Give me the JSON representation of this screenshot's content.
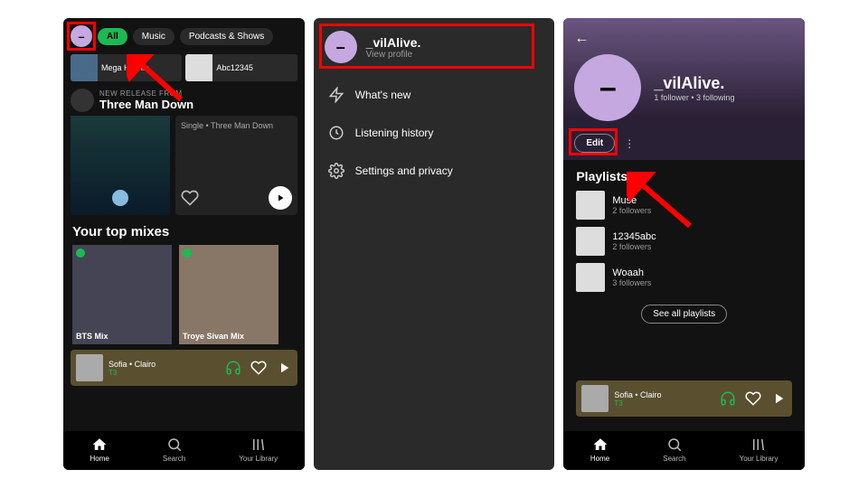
{
  "phone1": {
    "chips": {
      "all": "All",
      "music": "Music",
      "podcasts": "Podcasts & Shows"
    },
    "cards": [
      {
        "title": "Mega Hit Mix"
      },
      {
        "title": "Abc12345"
      }
    ],
    "release": {
      "label": "NEW RELEASE FROM",
      "artist": "Three Man Down",
      "meta": "Single • Three Man Down"
    },
    "mixes_title": "Your top mixes",
    "mixes": [
      {
        "label": "BTS Mix"
      },
      {
        "label": "Troye Sivan Mix"
      }
    ],
    "nowplaying": {
      "title": "Sofia • Clairo",
      "device": "T3"
    },
    "nav": {
      "home": "Home",
      "search": "Search",
      "library": "Your Library"
    }
  },
  "phone2": {
    "username": "_vilAlive.",
    "view_profile": "View profile",
    "items": {
      "whatsnew": "What's new",
      "history": "Listening history",
      "settings": "Settings and privacy"
    }
  },
  "phone3": {
    "username": "_vilAlive.",
    "followers": "1 follower • 3 following",
    "edit": "Edit",
    "playlists_title": "Playlists",
    "playlists": [
      {
        "name": "Muse",
        "sub": "2 followers"
      },
      {
        "name": "12345abc",
        "sub": "2 followers"
      },
      {
        "name": "Woaah",
        "sub": "3 followers"
      }
    ],
    "see_all": "See all playlists",
    "nowplaying": {
      "title": "Sofia • Clairo",
      "device": "T3"
    },
    "nav": {
      "home": "Home",
      "search": "Search",
      "library": "Your Library"
    }
  }
}
